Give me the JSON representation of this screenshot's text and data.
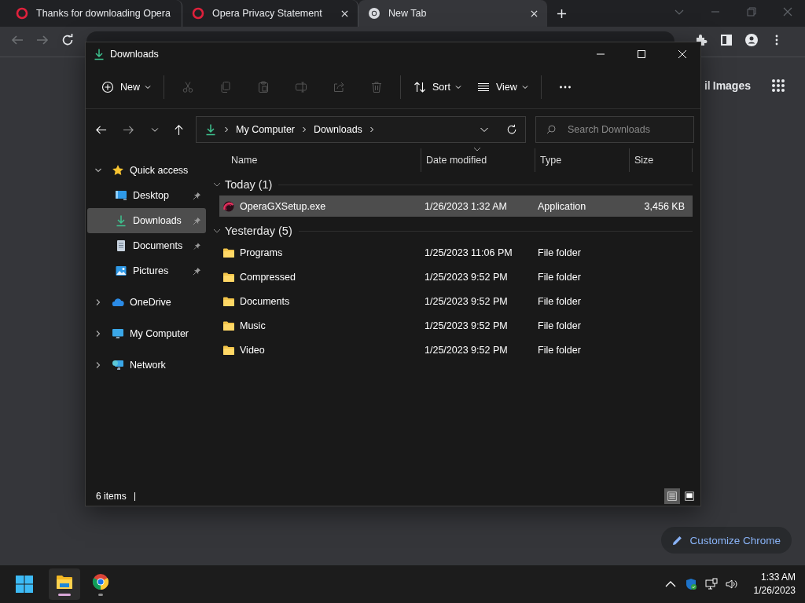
{
  "browser": {
    "tabs": [
      {
        "title": "Thanks for downloading Opera",
        "kind": "opera",
        "selected": false
      },
      {
        "title": "Opera Privacy Statement",
        "kind": "opera",
        "selected": false
      },
      {
        "title": "New Tab",
        "kind": "chrome",
        "selected": true
      }
    ],
    "page_links": [
      "il",
      "Images"
    ],
    "customize_button": "Customize Chrome"
  },
  "explorer": {
    "title": "Downloads",
    "commands": [
      {
        "kind": "new",
        "label": "New",
        "disabled": false
      },
      {
        "kind": "cut",
        "disabled": true
      },
      {
        "kind": "copy",
        "disabled": true
      },
      {
        "kind": "paste",
        "disabled": true
      },
      {
        "kind": "rename",
        "disabled": true
      },
      {
        "kind": "share",
        "disabled": true
      },
      {
        "kind": "delete",
        "disabled": true
      },
      {
        "kind": "sort",
        "label": "Sort",
        "disabled": false
      },
      {
        "kind": "view",
        "label": "View",
        "disabled": false
      },
      {
        "kind": "more",
        "disabled": false
      }
    ],
    "breadcrumbs": [
      "My Computer",
      "Downloads"
    ],
    "search": {
      "placeholder": "Search Downloads"
    },
    "nav": [
      {
        "label": "Quick access",
        "expanded": true,
        "selected": false,
        "children": [
          {
            "label": "Desktop",
            "pinned": true,
            "selected": false
          },
          {
            "label": "Downloads",
            "pinned": true,
            "selected": true
          },
          {
            "label": "Documents",
            "pinned": true,
            "selected": false
          },
          {
            "label": "Pictures",
            "pinned": true,
            "selected": false
          }
        ]
      },
      {
        "label": "OneDrive",
        "expanded": false,
        "selected": false
      },
      {
        "label": "My Computer",
        "expanded": false,
        "selected": false
      },
      {
        "label": "Network",
        "expanded": false,
        "selected": false
      }
    ],
    "columns": [
      {
        "label": "Name",
        "sorted": false
      },
      {
        "label": "Date modified",
        "sorted": true
      },
      {
        "label": "Type",
        "sorted": false
      },
      {
        "label": "Size",
        "sorted": false
      }
    ],
    "groups": [
      {
        "label": "Today (1)",
        "expanded": true,
        "items": [
          {
            "name": "OperaGXSetup.exe",
            "kind": "application",
            "date": "1/26/2023 1:32 AM",
            "type": "Application",
            "size": "3,456 KB",
            "selected": true
          }
        ]
      },
      {
        "label": "Yesterday (5)",
        "expanded": true,
        "items": [
          {
            "name": "Programs",
            "kind": "folder",
            "date": "1/25/2023 11:06 PM",
            "type": "File folder",
            "selected": false
          },
          {
            "name": "Compressed",
            "kind": "folder",
            "date": "1/25/2023 9:52 PM",
            "type": "File folder",
            "selected": false
          },
          {
            "name": "Documents",
            "kind": "folder",
            "date": "1/25/2023 9:52 PM",
            "type": "File folder",
            "selected": false
          },
          {
            "name": "Music",
            "kind": "folder",
            "date": "1/25/2023 9:52 PM",
            "type": "File folder",
            "selected": false
          },
          {
            "name": "Video",
            "kind": "folder",
            "date": "1/25/2023 9:52 PM",
            "type": "File folder",
            "selected": false
          }
        ]
      }
    ],
    "status": "6 items",
    "views": [
      {
        "kind": "details",
        "selected": true
      },
      {
        "kind": "tiles",
        "selected": false
      }
    ]
  },
  "taskbar": {
    "apps": [
      {
        "kind": "explorer",
        "selected": true
      },
      {
        "kind": "chrome",
        "selected": false
      }
    ],
    "time": "1:33 AM",
    "date": "1/26/2023"
  }
}
